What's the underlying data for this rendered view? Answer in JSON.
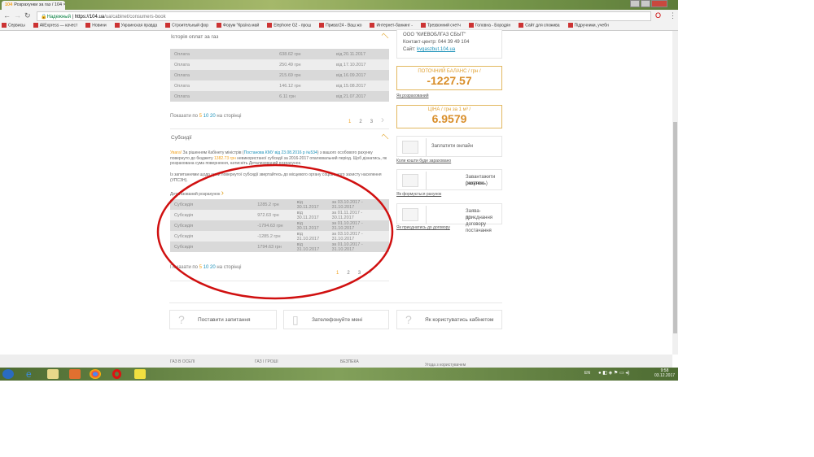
{
  "browser": {
    "tab_title": "Розрахунки за газ / 104",
    "tab_brand": "104",
    "secure_label": "Надежный",
    "url_host": "https://104.ua",
    "url_path": "/ua/cabinet/consumers-book",
    "bookmarks": [
      "Сервисы",
      "AliExpress — качест",
      "Новини",
      "Украинская правда",
      "Строительный фор",
      "Форум \"Країна май",
      "Elephone G2 - прош",
      "Приват24 - Ваш жо",
      "Интернет-банкинг -",
      "Трезвонний счетч",
      "Головна - Бородян",
      "Сайт для спожива",
      "Підручники, учебн"
    ]
  },
  "payments": {
    "title": "Історія оплат за газ",
    "rows": [
      [
        "Оплата",
        "638.62 грн",
        "від 20.11.2017"
      ],
      [
        "Оплата",
        "250.49 грн",
        "від 17.10.2017"
      ],
      [
        "Оплата",
        "215.69 грн",
        "від 16.09.2017"
      ],
      [
        "Оплата",
        "146.12 грн",
        "від 15.08.2017"
      ],
      [
        "Оплата",
        "6.11 грн",
        "від 21.07.2017"
      ]
    ],
    "pager": {
      "prefix": "Показати по",
      "opt1": "5",
      "opt2": "10",
      "opt3": "20",
      "suffix": "на сторінці",
      "pages": [
        "1",
        "2",
        "3"
      ]
    }
  },
  "subsidies": {
    "title": "Субсидії",
    "notice_attention": "Увага!",
    "notice_1": " За рішенням Кабінету міністрів (",
    "notice_link": "Постанова КМУ від 23.08.2016 р №534",
    "notice_2": ") з вашого особового рахунку повернуто до бюджету ",
    "notice_amount": "1382.73 грн",
    "notice_3": " невикористаної субсидії за 2016-2017 опалювальний період. Щоб дізнатись, як розрахована сума повернення, натисніть Детализований розрахунок.",
    "notice_para2": "Із запитаннями щодо суми повернутої субсидії звертайтесь до місцевого органу соціального захисту населення (УПСЗН).",
    "detail_link": "Деталізований розрахунок",
    "rows": [
      [
        "Субсидія",
        "1285.2 грн",
        "від 30.11.2017",
        "за 03.10.2017 - 31.10.2017"
      ],
      [
        "Субсидія",
        "972.63 грн",
        "від 30.11.2017",
        "за 01.11.2017 - 30.11.2017"
      ],
      [
        "Субсидія",
        "-1794.63 грн",
        "від 30.11.2017",
        "за 01.10.2017 - 31.10.2017"
      ],
      [
        "Субсидія",
        "-1285.2 грн",
        "від 31.10.2017",
        "за 03.10.2017 - 31.10.2017"
      ],
      [
        "Субсидія",
        "1794.63 грн",
        "від 31.10.2017",
        "за 01.10.2017 - 31.10.2017"
      ]
    ],
    "pager": {
      "prefix": "Показати по",
      "opt1": "5",
      "opt2": "10",
      "opt3": "20",
      "suffix": "на сторінці",
      "pages": [
        "1",
        "2",
        "3"
      ]
    }
  },
  "sidebar": {
    "company": "ООО \"КИЕВОБЛГАЗ СБЫТ\"",
    "contact": "Контакт-центр: 044 39 49 104",
    "site_label": "Сайт: ",
    "site_link": "kvgaszbut.104.ua",
    "balance_label": "ПОТОЧНИЙ БАЛАНС / грн /",
    "balance_value": "-1227.57",
    "balance_link": "Як розрахований",
    "price_label": "ЦІНА / грн за 1 м³ /",
    "price_value": "6.9579",
    "pay_label": "Заплатити онлайн",
    "pay_link": "Коли кошти буде зараховано",
    "bill_label": "Завантажити рахунок",
    "bill_sub": "(жовтень)",
    "bill_link": "Як формується рахунок",
    "contract_label": "Заява-приєднання",
    "contract_sub": "до договору постачання",
    "contract_link": "Як приєднатись до договору"
  },
  "help": {
    "ask": "Поставити запитання",
    "call": "Зателефонуйте мені",
    "how": "Як користуватись кабінетом"
  },
  "footer": {
    "c1": "ГАЗ В ОСЕЛІ",
    "c2": "ГАЗ І ГРОШІ",
    "c3": "БЕЗПЕКА",
    "c4": "Угода з користувачем"
  },
  "taskbar": {
    "lang": "EN",
    "time": "9:58",
    "date": "03.12.2017"
  },
  "colors": {
    "accent": "#f2a01a",
    "link": "#1a90b8",
    "annotation": "#d01010"
  }
}
